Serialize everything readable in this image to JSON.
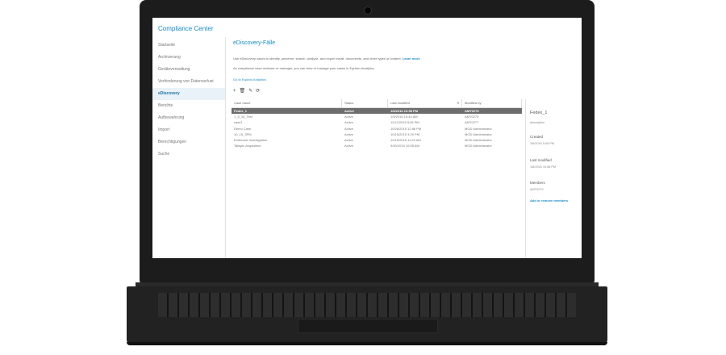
{
  "app": {
    "title": "Compliance Center"
  },
  "nav": {
    "items": [
      {
        "label": "Startseite"
      },
      {
        "label": "Archivierung"
      },
      {
        "label": "Geräteverwaltung"
      },
      {
        "label": "Verhinderung von Datenverlust"
      },
      {
        "label": "eDiscovery"
      },
      {
        "label": "Berichte"
      },
      {
        "label": "Aufbewahrung"
      },
      {
        "label": "Import"
      },
      {
        "label": "Berechtigungen"
      },
      {
        "label": "Suche"
      }
    ],
    "active_index": 4
  },
  "main": {
    "title": "eDiscovery-Fälle",
    "description_1": "Use eDiscovery cases to identify, preserve, search, analyze, and export email, documents, and other types of content.",
    "learn_more": "Learn more",
    "description_2": "As compliance case reviewer or manager, you can view or manage your cases in Equivio Analytics.",
    "equivio_link": "Go to Equivio Analytics",
    "toolbar": {
      "add_icon": "+",
      "delete_icon": "🗑",
      "edit_icon": "✎",
      "refresh_icon": "⟳"
    }
  },
  "grid": {
    "columns": [
      "Case name",
      "Status",
      "Last modified",
      "Modified by"
    ],
    "rows": [
      {
        "name": "Fedex_1",
        "status": "Active",
        "modified": "1/6/2016 10:58 PM",
        "by": "AMT0279"
      },
      {
        "name": "1_5_16_Test",
        "status": "Active",
        "modified": "1/5/2016 10:44 AM",
        "by": "AMT0279"
      },
      {
        "name": "case1",
        "status": "Active",
        "modified": "11/12/2015 5:06 PM",
        "by": "AMT0277"
      },
      {
        "name": "Demo Case",
        "status": "Active",
        "modified": "10/26/2015 12:56 PM",
        "by": "MOD Administrator"
      },
      {
        "name": "10_15_3PM",
        "status": "Active",
        "modified": "10/15/2015 3:20 PM",
        "by": "MOD Administrator"
      },
      {
        "name": "Embezzle Investigation",
        "status": "Active",
        "modified": "10/15/2015 11:20 AM",
        "by": "MOD Administrator"
      },
      {
        "name": "Tailspin Acquisition",
        "status": "Active",
        "modified": "9/30/2015 10:55 AM",
        "by": "MOD Administrator"
      }
    ],
    "selected_index": 0,
    "sort_icon": "▾"
  },
  "details": {
    "title": "Fedex_1",
    "description_label": "description",
    "created_label": "Created",
    "created_value": "1/6/2016 5:06 PM",
    "last_modified_label": "Last modified",
    "last_modified_value": "1/6/2016 10:58 PM",
    "members_label": "Members",
    "members_value": "AMT0279",
    "add_remove_link": "Add or remove members"
  }
}
